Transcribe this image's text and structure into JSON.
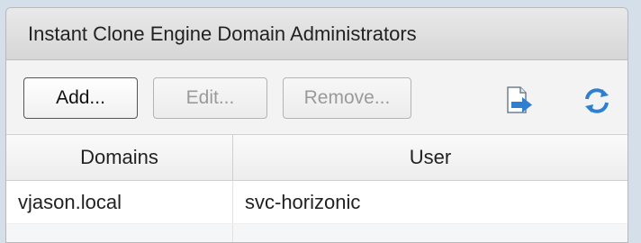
{
  "panel": {
    "title": "Instant Clone Engine Domain Administrators"
  },
  "toolbar": {
    "add_label": "Add...",
    "edit_label": "Edit...",
    "remove_label": "Remove...",
    "export_icon": "export-icon",
    "refresh_icon": "refresh-icon"
  },
  "table": {
    "columns": [
      "Domains",
      "User"
    ],
    "rows": [
      {
        "domain": "vjason.local",
        "user": "svc-horizonic"
      }
    ]
  },
  "colors": {
    "accent_blue": "#2f7fd1",
    "panel_border": "#b9b9b9"
  }
}
